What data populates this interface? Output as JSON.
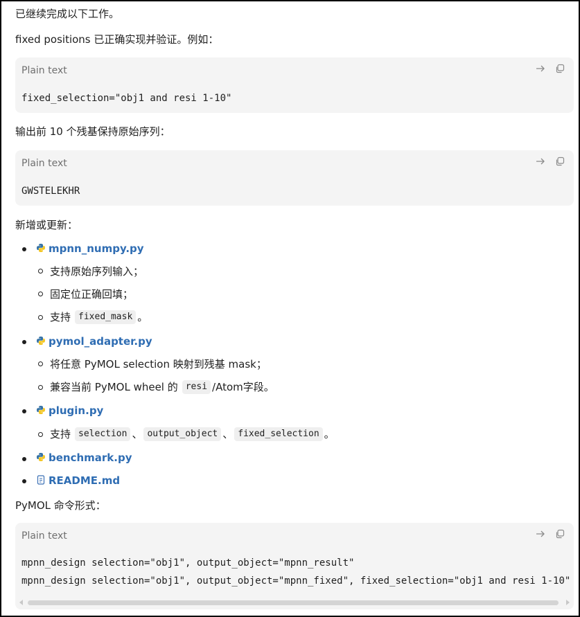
{
  "intro": "已继续完成以下工作。",
  "verified_line": "fixed positions 已正确实现并验证。例如：",
  "code_block_1": {
    "lang": "Plain text",
    "code": "fixed_selection=\"obj1 and resi 1-10\""
  },
  "output_line": "输出前 10 个残基保持原始序列：",
  "code_block_2": {
    "lang": "Plain text",
    "code": "GWSTELEKHR"
  },
  "updates_heading": "新增或更新：",
  "files": [
    {
      "name": "mpnn_numpy.py",
      "icon": "python-icon",
      "details": [
        {
          "text": "支持原始序列输入；"
        },
        {
          "text": "固定位正确回填；"
        },
        {
          "pre": "支持",
          "code": "fixed_mask",
          "post": "。"
        }
      ]
    },
    {
      "name": "pymol_adapter.py",
      "icon": "python-icon",
      "details": [
        {
          "text": "将任意 PyMOL selection 映射到残基 mask；"
        },
        {
          "pre": "兼容当前 PyMOL wheel 的",
          "code": "resi",
          "post": "/Atom字段。"
        }
      ]
    },
    {
      "name": "plugin.py",
      "icon": "python-icon",
      "details": [
        {
          "pre": "支持",
          "code1": "selection",
          "sep1": "、",
          "code2": "output_object",
          "sep2": "、",
          "code3": "fixed_selection",
          "post": "。"
        }
      ]
    },
    {
      "name": "benchmark.py",
      "icon": "python-icon"
    },
    {
      "name": "README.md",
      "icon": "document-icon"
    }
  ],
  "command_heading": "PyMOL 命令形式：",
  "code_block_3": {
    "lang": "Plain text",
    "line1": "mpnn_design selection=\"obj1\", output_object=\"mpnn_result\"",
    "line2": "mpnn_design selection=\"obj1\", output_object=\"mpnn_fixed\", fixed_selection=\"obj1 and resi 1-10\""
  },
  "colors": {
    "link": "#2f6db3",
    "python_blue": "#3572a5",
    "python_yellow": "#f3c623",
    "code_bg": "#f4f4f4"
  }
}
